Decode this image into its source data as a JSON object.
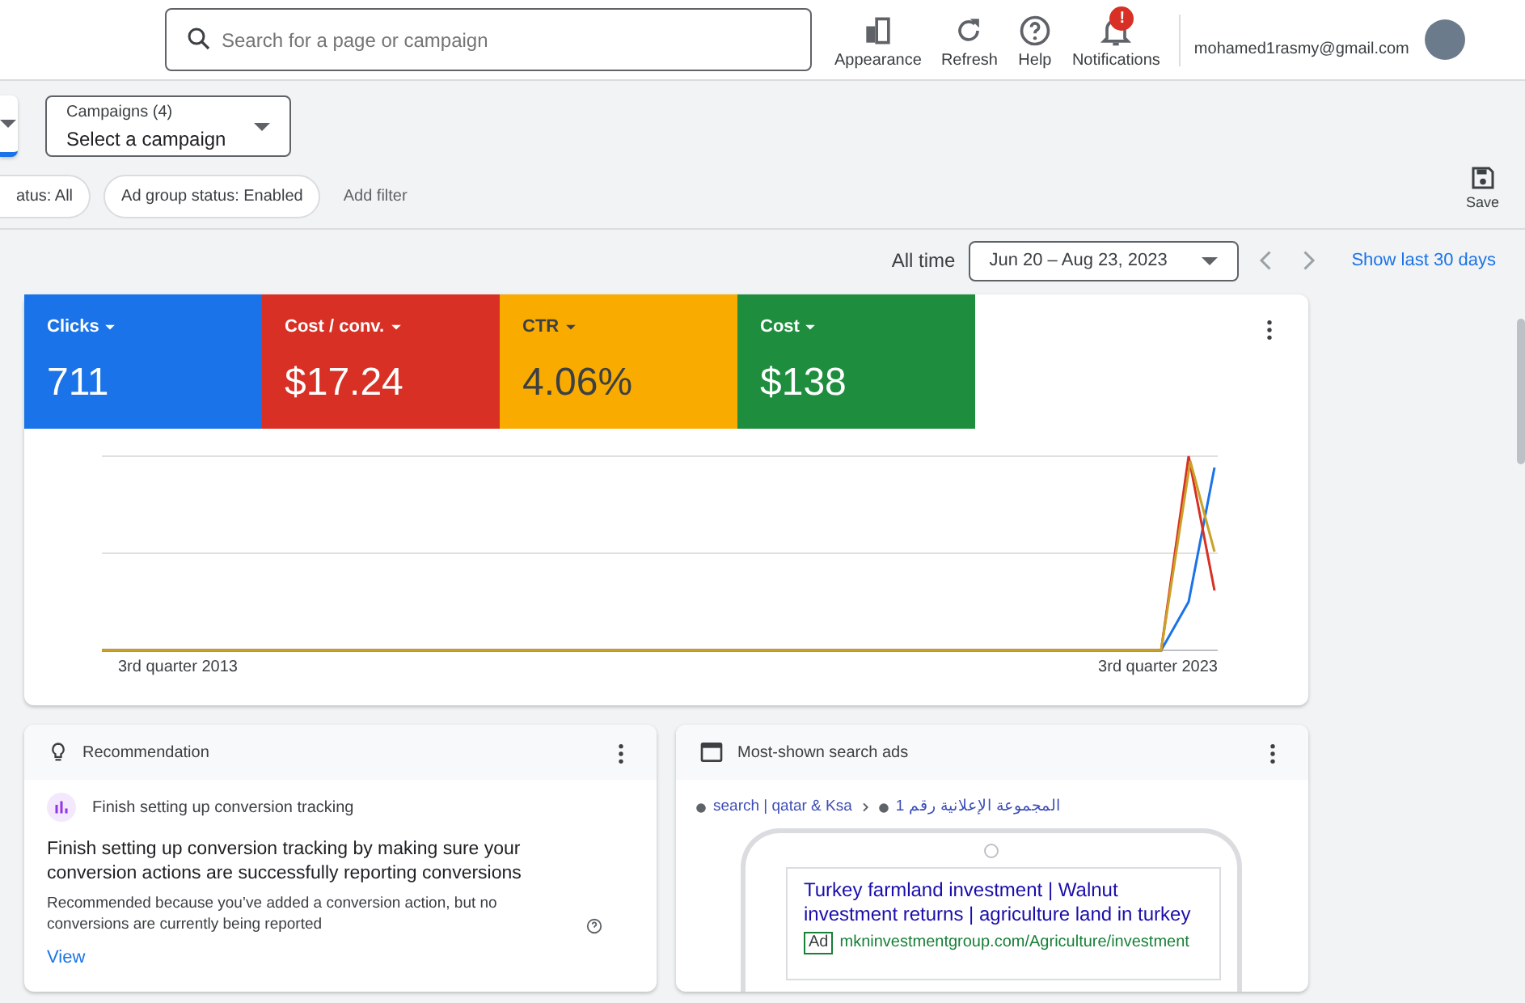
{
  "topbar": {
    "search": {
      "placeholder": "Search for a page or campaign"
    },
    "actions": [
      {
        "kind": "appearance",
        "label": "Appearance"
      },
      {
        "kind": "refresh",
        "label": "Refresh"
      },
      {
        "kind": "help",
        "label": "Help"
      },
      {
        "kind": "notifications",
        "label": "Notifications",
        "badge": "!"
      }
    ],
    "account": "mohamed1rasmy@gmail.com"
  },
  "selectors": {
    "campaigns": {
      "label": "Campaigns (4)",
      "value": "Select a campaign"
    }
  },
  "filters": [
    {
      "label": "atus: All"
    },
    {
      "label": "Ad group status: Enabled"
    }
  ],
  "add_filter": "Add filter",
  "save": "Save",
  "date_bar": {
    "range_label": "All time",
    "range": "Jun 20 – Aug 23, 2023",
    "show_last": "Show last 30 days"
  },
  "metrics": [
    {
      "label": "Clicks",
      "value": "711",
      "color": "#1a73e8",
      "selected": true
    },
    {
      "label": "Cost / conv.",
      "value": "$17.24",
      "color": "#d93025",
      "selected": true
    },
    {
      "label": "CTR",
      "value": "4.06%",
      "color": "#f9ab00",
      "selected": true
    },
    {
      "label": "Cost",
      "value": "$138",
      "color": "#1e8e3e",
      "selected": true
    }
  ],
  "chart": {
    "x_labels": [
      "3rd quarter 2013",
      "3rd quarter 2023"
    ]
  },
  "recommendation": {
    "title": "Recommendation",
    "item": "Finish setting up conversion tracking",
    "heading": "Finish setting up conversion tracking by making sure your conversion actions are successfully reporting conversions",
    "note": "Recommended because you’ve added a conversion action, but no conversions are currently being reported",
    "link": "View"
  },
  "ads": {
    "title": "Most-shown search ads",
    "breadcrumb": [
      "search | qatar & Ksa",
      "المجموعة الإعلانية رقم 1"
    ],
    "ad_title": "Turkey farmland investment | Walnut investment returns | agriculture land in turkey",
    "ad_badge": "Ad",
    "ad_url": "mkninvestmentgroup.com/Agriculture/investment"
  }
}
